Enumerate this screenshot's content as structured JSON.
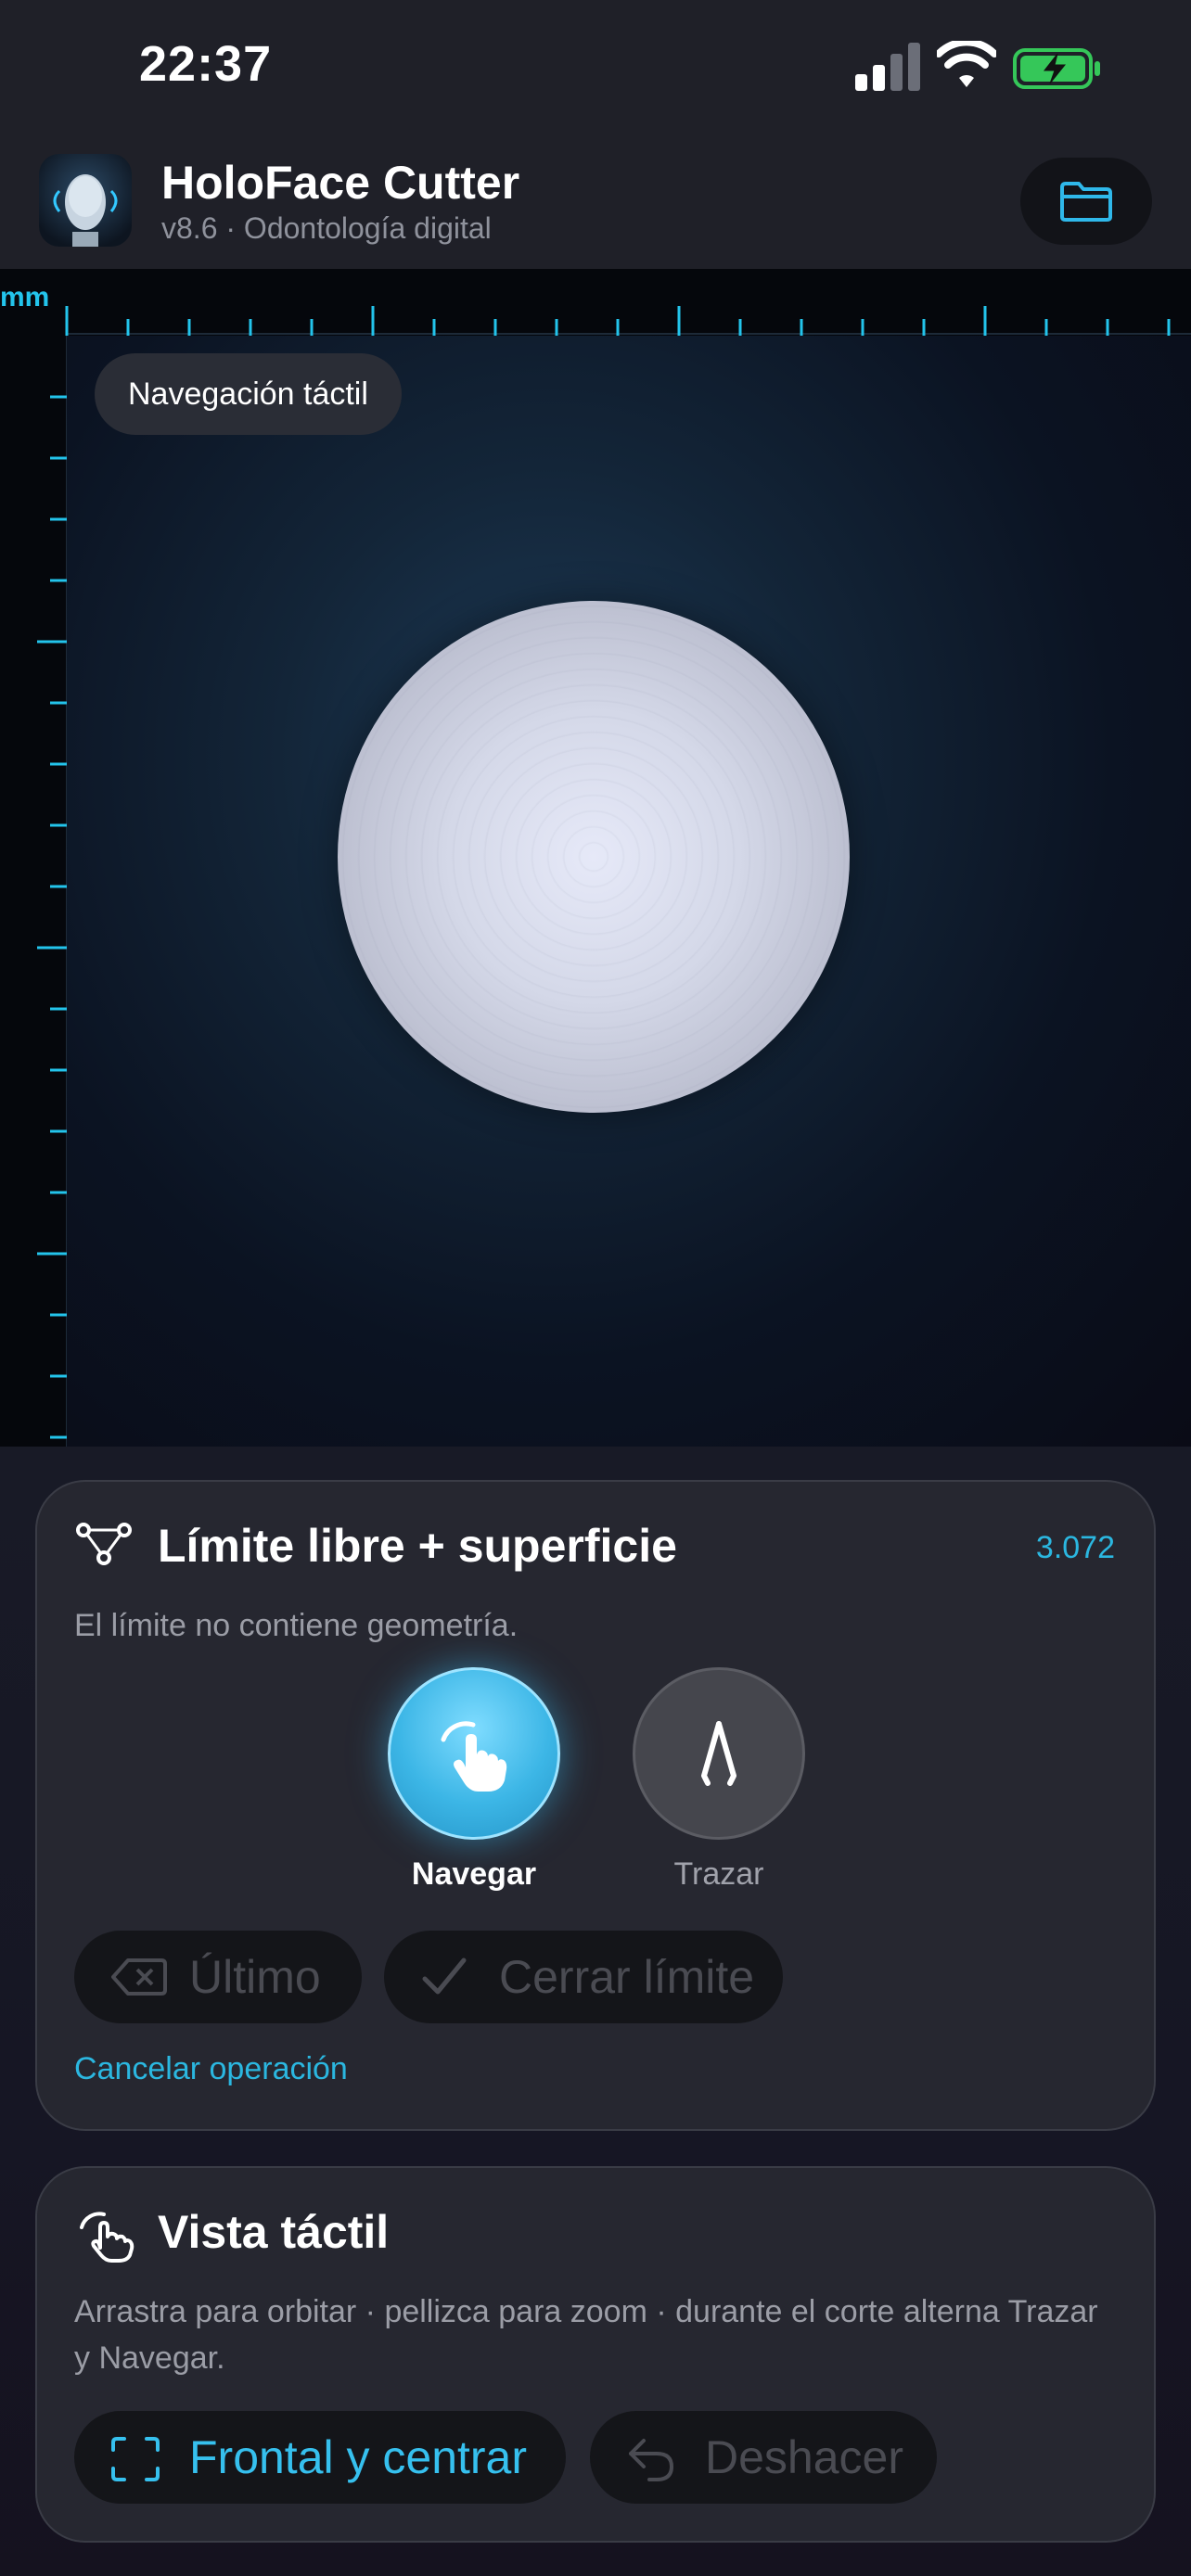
{
  "status_bar": {
    "time": "22:37",
    "icons": [
      "cellular-signal-icon",
      "wifi-icon",
      "battery-charging-icon"
    ]
  },
  "header": {
    "title": "HoloFace Cutter",
    "subtitle": "v8.6 · Odontología digital",
    "folder_icon": "folder-icon"
  },
  "viewport": {
    "unit_label": "mm",
    "mode_pill": "Navegación táctil"
  },
  "boundary_card": {
    "title": "Límite libre + superficie",
    "count": "3.072",
    "description": "El límite no contiene geometría.",
    "modes": [
      {
        "label": "Navegar",
        "icon": "hand-pointer-icon",
        "selected": true
      },
      {
        "label": "Trazar",
        "icon": "compass-draw-icon",
        "selected": false
      }
    ],
    "last_button": "Último",
    "close_button": "Cerrar límite",
    "cancel_link": "Cancelar operación"
  },
  "touch_card": {
    "title": "Vista táctil",
    "description": "Arrastra para orbitar · pellizca para zoom · durante el corte alterna Trazar y Navegar.",
    "front_button": "Frontal y centrar",
    "undo_button": "Deshacer"
  },
  "colors": {
    "accent": "#2bb7e0",
    "card_bg": "#262730",
    "background": "#181a24"
  }
}
